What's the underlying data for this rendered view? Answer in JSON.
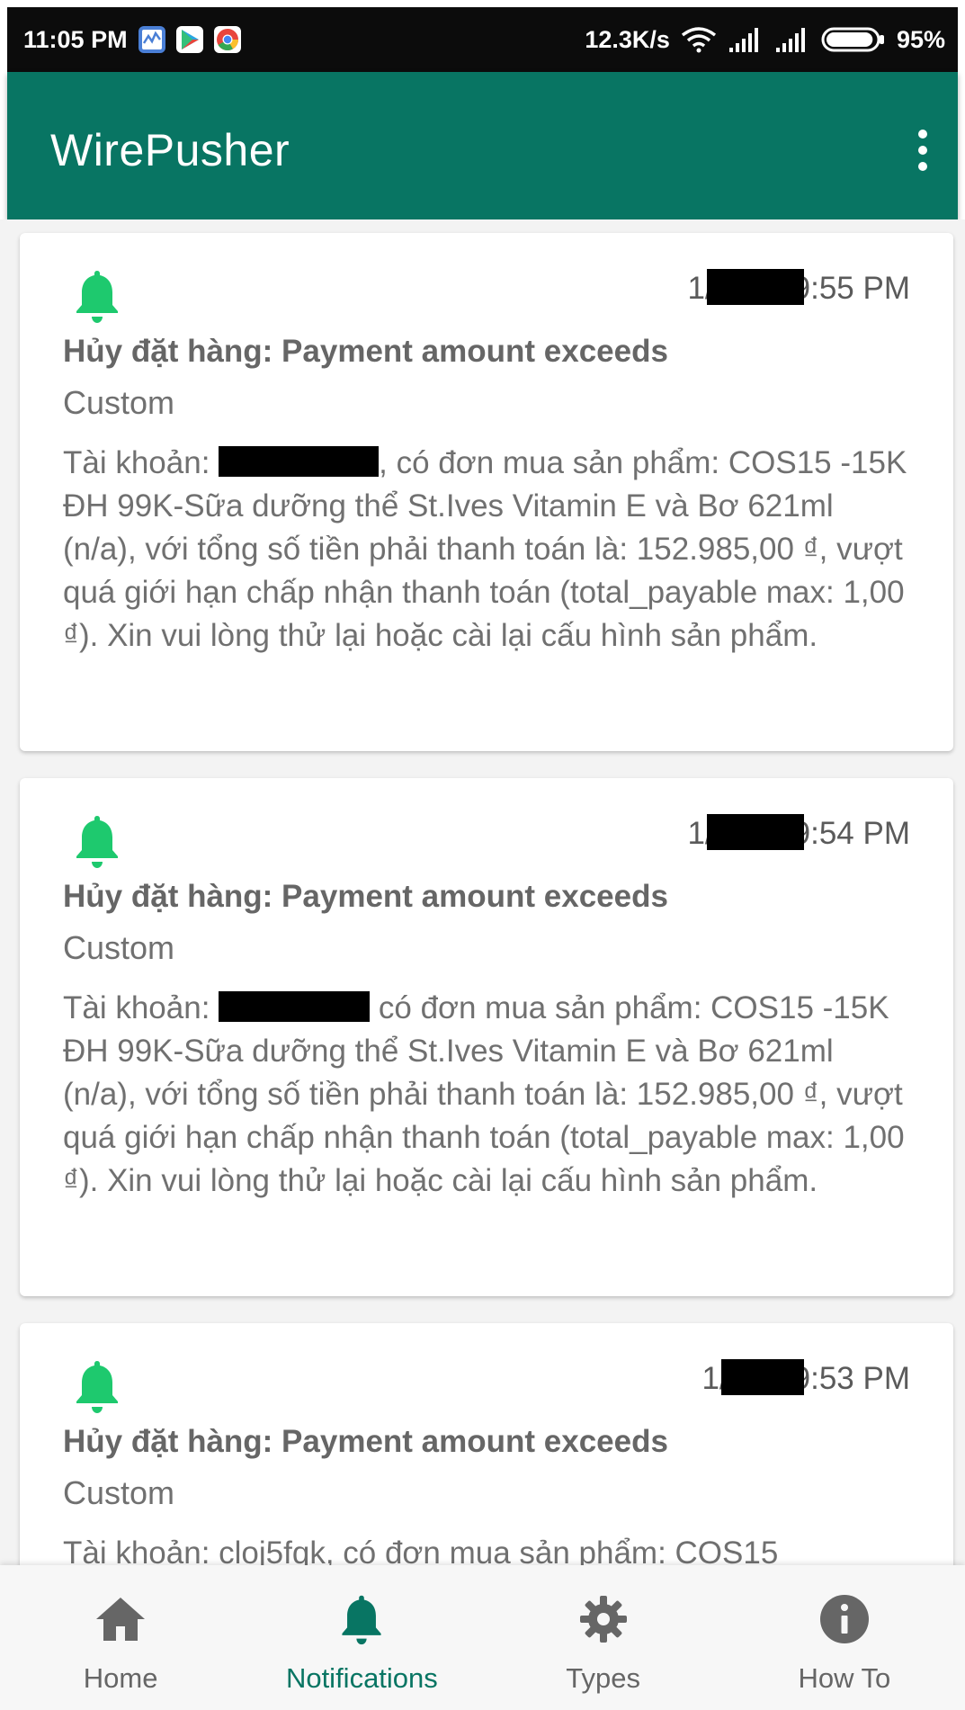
{
  "status_bar": {
    "time": "11:05 PM",
    "net_speed": "12.3K/s",
    "battery": "95%",
    "battery_level": 0.95,
    "icons": [
      "activity-icon",
      "play-store-icon",
      "chrome-icon",
      "wifi-icon",
      "signal-icon",
      "signal-icon",
      "battery-icon"
    ]
  },
  "app_bar": {
    "title": "WirePusher",
    "menu_icon": "more-vert-icon"
  },
  "colors": {
    "primary": "#087563",
    "bell": "#1ec96e",
    "inactive": "#666666"
  },
  "notifications": [
    {
      "date_visible": "1/",
      "time": "9:55 PM",
      "title": "Hủy đặt hàng: Payment amount exceeds",
      "type": "Custom",
      "body_before": "Tài khoản: ",
      "body_after": ", có đơn mua sản phẩm: COS15 -15K ĐH 99K-Sữa dưỡng thể St.Ives Vitamin E và Bơ 621ml (n/a), với tổng số tiền phải thanh toán là: 152.985,00 ₫, vượt quá giới hạn chấp nhận thanh toán (total_payable max: 1,00 ₫). Xin vui lòng thử lại hoặc cài lại cấu hình sản phẩm."
    },
    {
      "date_visible": "1/",
      "time": "9:54 PM",
      "title": "Hủy đặt hàng: Payment amount exceeds",
      "type": "Custom",
      "body_before": "Tài khoản: ",
      "body_after": " có đơn mua sản phẩm: COS15 -15K ĐH 99K-Sữa dưỡng thể St.Ives Vitamin E và Bơ 621ml (n/a), với tổng số tiền phải thanh toán là: 152.985,00 ₫, vượt quá giới hạn chấp nhận thanh toán (total_payable max: 1,00 ₫). Xin vui lòng thử lại hoặc cài lại cấu hình sản phẩm."
    },
    {
      "date_visible": "1/",
      "time": "9:53 PM",
      "title": "Hủy đặt hàng: Payment amount exceeds",
      "type": "Custom",
      "body_before": "Tài khoản: cloj5fqk, có đơn mua sản phẩm: COS15",
      "body_after": ""
    }
  ],
  "bottom_nav": {
    "items": [
      {
        "label": "Home",
        "icon": "home-icon",
        "active": false
      },
      {
        "label": "Notifications",
        "icon": "bell-icon",
        "active": true
      },
      {
        "label": "Types",
        "icon": "gear-icon",
        "active": false
      },
      {
        "label": "How To",
        "icon": "info-icon",
        "active": false
      }
    ]
  }
}
